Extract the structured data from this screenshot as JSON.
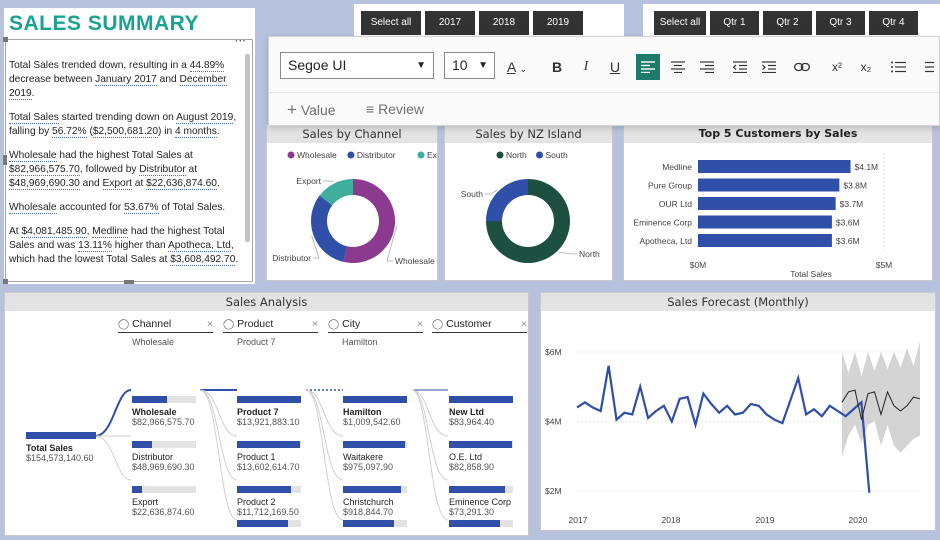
{
  "summary": {
    "title": "SALES SUMMARY",
    "p1": {
      "a": "Total Sales trended down, resulting in a ",
      "b": "44.89%",
      "c": " decrease between ",
      "d": "January 2017",
      "e": " and ",
      "f": "December 2019",
      "g": "."
    },
    "p2": {
      "a": "Total Sales",
      "b": " started trending down on ",
      "c": "August 2019",
      "d": ", falling by ",
      "e": "56.72%",
      "f": " (",
      "g": "$2,500,681.20",
      "h": ") in ",
      "i": "4 months",
      "j": "."
    },
    "p3": {
      "a": "Wholesale",
      "b": " had the highest Total Sales at ",
      "c": "$82,966,575.70",
      "d": ", followed by ",
      "e": "Distributor",
      "f": " at ",
      "g": "$48,969,690.30",
      "h": " and ",
      "i": "Export",
      "j": " at ",
      "k": "$22,636,874.60",
      "l": "."
    },
    "p4": {
      "a": "Wholesale",
      "b": " accounted for ",
      "c": "53.67%",
      "d": " of Total Sales."
    },
    "p5": {
      "a": "At ",
      "b": "$4,081,485.90",
      "c": ", ",
      "d": "Medline",
      "e": " had the highest Total Sales and was ",
      "f": "13.11%",
      "g": " higher than ",
      "h": "Apotheca, Ltd",
      "i": ", which had the lowest Total Sales at ",
      "j": "$3,608,492.70",
      "k": "."
    }
  },
  "year_slicer": [
    "Select all",
    "2017",
    "2018",
    "2019"
  ],
  "qtr_slicer": [
    "Select all",
    "Qtr 1",
    "Qtr 2",
    "Qtr 3",
    "Qtr 4"
  ],
  "toolbar": {
    "font": "Segoe UI",
    "size": "10",
    "font_color_glyph": "A",
    "bold": "B",
    "italic": "I",
    "underline": "U",
    "superscript": "x²",
    "subscript": "x₂",
    "add_value": "Value",
    "review": "Review"
  },
  "colors": {
    "blue": "#2f4fa8",
    "purple": "#8b3a8f",
    "teal": "#3fae9c",
    "dark_green": "#1d5040",
    "accent_teal": "#1aa392"
  },
  "chart_data": [
    {
      "type": "pie",
      "title": "Sales by Channel",
      "legend": [
        "Wholesale",
        "Distributor",
        "Export"
      ],
      "categories": [
        "Wholesale",
        "Distributor",
        "Export"
      ],
      "values": [
        82966575.7,
        48969690.3,
        22636874.6
      ],
      "colors": [
        "#8b3a8f",
        "#2f4fa8",
        "#3fae9c"
      ]
    },
    {
      "type": "pie",
      "title": "Sales by NZ Island",
      "legend": [
        "North",
        "South"
      ],
      "categories": [
        "North",
        "South"
      ],
      "values": [
        75,
        25
      ],
      "colors": [
        "#1d5040",
        "#2f4fa8"
      ]
    },
    {
      "type": "bar",
      "title": "Top 5 Customers by Sales",
      "categories": [
        "Medline",
        "Pure Group",
        "OUR Ltd",
        "Eminence Corp",
        "Apotheca, Ltd"
      ],
      "values": [
        4.1,
        3.8,
        3.7,
        3.6,
        3.6
      ],
      "data_labels": [
        "$4.1M",
        "$3.8M",
        "$3.7M",
        "$3.6M",
        "$3.6M"
      ],
      "x_ticks": [
        "$0M",
        "$5M"
      ],
      "xlabel": "Total Sales",
      "xlim": [
        0,
        5
      ]
    },
    {
      "type": "line",
      "title": "Sales Forecast (Monthly)",
      "x_ticks": [
        "2017",
        "2018",
        "2019",
        "2020"
      ],
      "y_ticks": [
        "$6M",
        "$4M",
        "$2M"
      ],
      "ylim": [
        2,
        6.6
      ],
      "series": [
        {
          "values": [
            4.4,
            4.55,
            4.4,
            4.3,
            5.6,
            4.05,
            4.25,
            4.2,
            5.0,
            4.1,
            4.3,
            4.45,
            4.0,
            4.65,
            4.7,
            3.9,
            4.8,
            4.5,
            4.25,
            4.45,
            4.2,
            4.25,
            4.5,
            4.45,
            4.2,
            4.05,
            3.95,
            4.6,
            5.25,
            4.2,
            4.35,
            4.15,
            4.45,
            4.3,
            4.15,
            4.35,
            4.55,
            1.95
          ]
        },
        {
          "values": [
            4.55,
            4.85,
            4.9,
            4.05,
            4.8,
            4.85,
            4.2,
            4.85,
            4.45,
            4.3,
            4.45,
            4.7,
            4.65
          ]
        },
        {
          "values": [
            6.0,
            5.4,
            6.0,
            5.3,
            6.0,
            5.45,
            6.0,
            5.5,
            6.0,
            5.55,
            6.1,
            5.6,
            6.3
          ]
        },
        {
          "values": [
            3.0,
            3.6,
            3.9,
            3.4,
            3.9,
            4.0,
            3.3,
            3.9,
            3.3,
            3.1,
            3.3,
            3.5,
            3.6
          ]
        }
      ]
    }
  ],
  "tree": {
    "title": "Sales Analysis",
    "columns": [
      {
        "label": "Channel",
        "sub": "Wholesale"
      },
      {
        "label": "Product",
        "sub": "Product 7"
      },
      {
        "label": "City",
        "sub": "Hamilton"
      },
      {
        "label": "Customer",
        "sub": ""
      }
    ],
    "root": {
      "name": "Total Sales",
      "value": "$154,573,140.60"
    },
    "col1": [
      {
        "name": "Wholesale",
        "value": "$82,966,575.70",
        "pct": 0.54,
        "bold": true
      },
      {
        "name": "Distributor",
        "value": "$48,969,690.30",
        "pct": 0.32
      },
      {
        "name": "Export",
        "value": "$22,636,874.60",
        "pct": 0.15
      }
    ],
    "col2": [
      {
        "name": "Product 7",
        "value": "$13,921,883.10",
        "pct": 1.0,
        "bold": true
      },
      {
        "name": "Product 1",
        "value": "$13,602,614.70",
        "pct": 0.98
      },
      {
        "name": "Product 2",
        "value": "$11,712,169.50",
        "pct": 0.84
      }
    ],
    "col3": [
      {
        "name": "Hamilton",
        "value": "$1,009,542.60",
        "pct": 1.0,
        "bold": true
      },
      {
        "name": "Waitakere",
        "value": "$975,097.90",
        "pct": 0.97
      },
      {
        "name": "Christchurch",
        "value": "$918,844.70",
        "pct": 0.91
      }
    ],
    "col4": [
      {
        "name": "New Ltd",
        "value": "$83,964.40",
        "pct": 1.0,
        "bold": true
      },
      {
        "name": "O.E. Ltd",
        "value": "$82,858.90",
        "pct": 0.99
      },
      {
        "name": "Eminence Corp",
        "value": "$73,291.30",
        "pct": 0.87
      }
    ]
  }
}
